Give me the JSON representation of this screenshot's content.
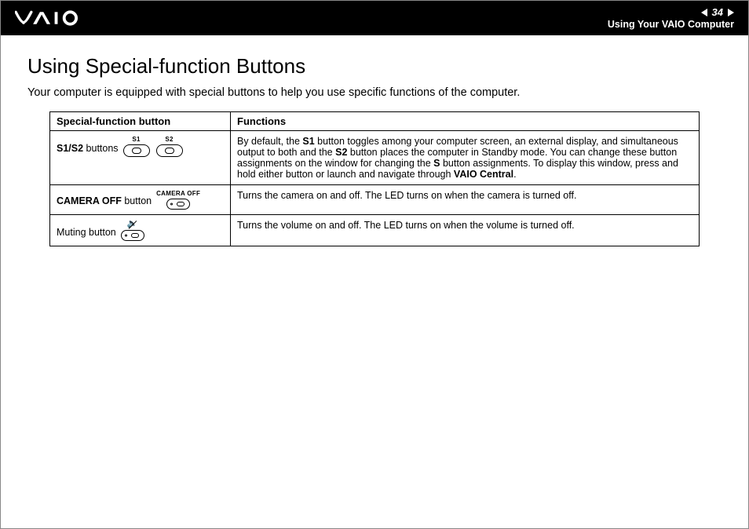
{
  "header": {
    "page_number": "34",
    "section": "Using Your VAIO Computer"
  },
  "page": {
    "title": "Using Special-function Buttons",
    "intro": "Your computer is equipped with special buttons to help you use specific functions of the computer."
  },
  "table": {
    "headers": {
      "col1": "Special-function button",
      "col2": "Functions"
    },
    "rows": [
      {
        "label_bold": "S1/S2",
        "label_rest": " buttons",
        "icon_caps": [
          "S1",
          "S2"
        ],
        "func_pre": "By default, the ",
        "func_b1": "S1",
        "func_mid1": " button toggles among your computer screen, an external display, and simultaneous output to both and the ",
        "func_b2": "S2",
        "func_mid2": " button places the computer in Standby mode. You can change these button assignments on the window for changing the ",
        "func_b3": "S",
        "func_mid3": " button assignments. To display this window, press and hold either button or launch and navigate through ",
        "func_b4": "VAIO Central",
        "func_post": "."
      },
      {
        "label_bold": "CAMERA OFF",
        "label_rest": " button",
        "icon_cap": "CAMERA OFF",
        "func": "Turns the camera on and off. The LED turns on when the camera is turned off."
      },
      {
        "label_plain": "Muting button",
        "func": "Turns the volume on and off. The LED turns on when the volume is turned off."
      }
    ]
  }
}
